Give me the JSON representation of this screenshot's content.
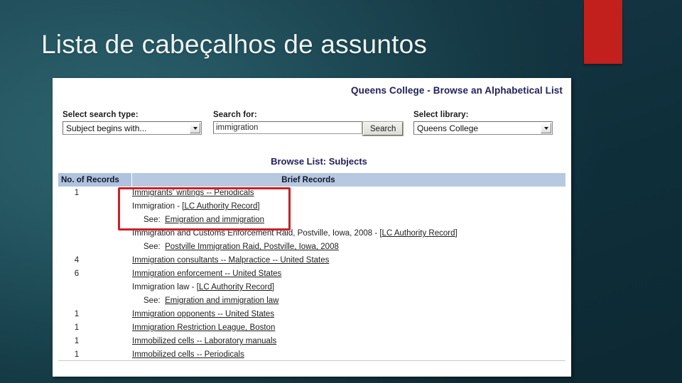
{
  "slide": {
    "title": "Lista de cabeçalhos de assuntos",
    "accent_color": "#c1201c",
    "background_color": "#1b4a56"
  },
  "app": {
    "title": "Queens College - Browse an Alphabetical List",
    "title_color": "#21215e"
  },
  "form": {
    "search_type": {
      "label": "Select search type:",
      "value": "Subject begins with..."
    },
    "search_for": {
      "label": "Search for:",
      "value": "immigration",
      "placeholder": "immigration"
    },
    "search_button": "Search",
    "library": {
      "label": "Select library:",
      "value": "Queens College"
    }
  },
  "browse": {
    "heading": "Browse List: Subjects",
    "columns": {
      "count": "No. of Records",
      "brief": "Brief Records"
    },
    "rows": [
      {
        "count": "1",
        "text": "Immigrants' writings -- Periodicals",
        "link": true,
        "see": null
      },
      {
        "count": "",
        "text": "Immigration - [LC Authority Record]",
        "link": false,
        "partial_link": "[LC Authority Record]",
        "see": {
          "label": "See:",
          "text": "Emigration and immigration"
        }
      },
      {
        "count": "",
        "text": "Immigration and Customs Enforcement Raid, Postville, Iowa, 2008 - [LC Authority Record]",
        "link": false,
        "partial_link": "[LC Authority Record]",
        "see": {
          "label": "See:",
          "text": "Postville Immigration Raid, Postville, Iowa, 2008"
        }
      },
      {
        "count": "4",
        "text": "Immigration consultants -- Malpractice -- United States",
        "link": true,
        "see": null
      },
      {
        "count": "6",
        "text": "Immigration enforcement -- United States",
        "link": true,
        "see": null
      },
      {
        "count": "",
        "text": "Immigration law - [LC Authority Record]",
        "link": false,
        "partial_link": "[LC Authority Record]",
        "see": {
          "label": "See:",
          "text": "Emigration and immigration law"
        }
      },
      {
        "count": "1",
        "text": "Immigration opponents -- United States",
        "link": true,
        "see": null
      },
      {
        "count": "1",
        "text": "Immigration Restriction League, Boston",
        "link": true,
        "see": null
      },
      {
        "count": "1",
        "text": "Immobilized cells -- Laboratory manuals",
        "link": true,
        "see": null
      },
      {
        "count": "1",
        "text": "Immobilized cells -- Periodicals",
        "link": true,
        "see": null
      }
    ]
  },
  "annotation": {
    "highlight_color": "#cc2027"
  }
}
